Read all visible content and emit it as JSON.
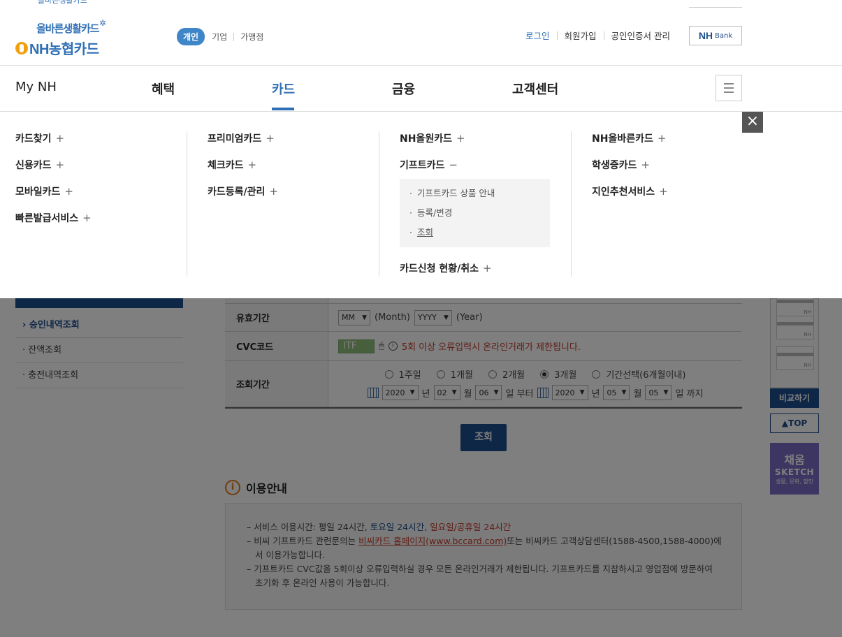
{
  "header": {
    "logo_sub": "올바른생활카드",
    "logo_main": "NH농협카드",
    "tabs": [
      "개인",
      "기업",
      "가맹점"
    ],
    "util": [
      "로그인",
      "회원가입",
      "공인인증서 관리"
    ],
    "bank_a": "NH",
    "bank_b": "Bank"
  },
  "gnb": {
    "items": [
      "My NH",
      "혜택",
      "카드",
      "금융",
      "고객센터"
    ],
    "active": "카드"
  },
  "mega": {
    "col1": [
      "카드찾기",
      "신용카드",
      "모바일카드",
      "빠른발급서비스"
    ],
    "col2": [
      "프리미엄카드",
      "체크카드",
      "카드등록/관리"
    ],
    "col3": [
      "NH올원카드",
      "기프트카드",
      "카드신청 현황/취소"
    ],
    "col3_sub": [
      "기프트카드 상품 안내",
      "등록/변경",
      "조회"
    ],
    "col4": [
      "NH올바른카드",
      "학생증카드",
      "지인추천서비스"
    ],
    "plus": "+",
    "minus": "−",
    "close": "×"
  },
  "left_nav": [
    "승인내역조회",
    "잔액조회",
    "충전내역조회"
  ],
  "form": {
    "exp_label": "유효기간",
    "mm": "MM",
    "month_txt": "(Month)",
    "yyyy": "YYYY",
    "year_txt": "(Year)",
    "cvc_label": "CVC코드",
    "cvc_value": "ITF",
    "cvc_warn": "5회 이상 오류입력시 온라인거래가 제한됩니다.",
    "period_label": "조회기간",
    "radios": [
      "1주일",
      "1개월",
      "2개월",
      "3개월",
      "기간선택(6개월이내)"
    ],
    "radio_selected": "3개월",
    "from": {
      "y": "2020",
      "m": "02",
      "d": "06"
    },
    "to": {
      "y": "2020",
      "m": "05",
      "d": "05"
    },
    "nyeon": "년",
    "wol": "월",
    "il_buteo": "일 부터",
    "il_kkaji": "일 까지"
  },
  "search_btn": "조회",
  "info": {
    "title": "이용안내",
    "l1_a": "– 서비스 이용시간: 평일 24시간, ",
    "l1_b": "토요일 24시간",
    "l1_c": ", ",
    "l1_d": "일요일/공휴일 24시간",
    "l2_a": "– 비씨 기프트카드 관련문의는 ",
    "l2_link": "비씨카드 홈페이지(www.bccard.com)",
    "l2_b": "또는 비씨카드 고객상담센터(1588-4500,1588-4000)에 서 이용가능합니다.",
    "l3": "– 기프트카드 CVC값을 5회이상 오류입력하실 경우 모든 온라인거래가 제한됩니다. 기프트카드를 지참하시고 영업점에 방문하여 초기화 후 온라인 사용이 가능합니다."
  },
  "quick": {
    "mini_label": "NH",
    "compare": "비교하기",
    "top": "▲TOP",
    "sketch_1": "채움",
    "sketch_2": "SKETCH",
    "sketch_3": "생활, 문화, 할인"
  },
  "colors": {
    "brand_blue": "#2f6fb5",
    "navy": "#1f4e8c",
    "warn_red": "#c0392b",
    "orange": "#e07b14"
  }
}
